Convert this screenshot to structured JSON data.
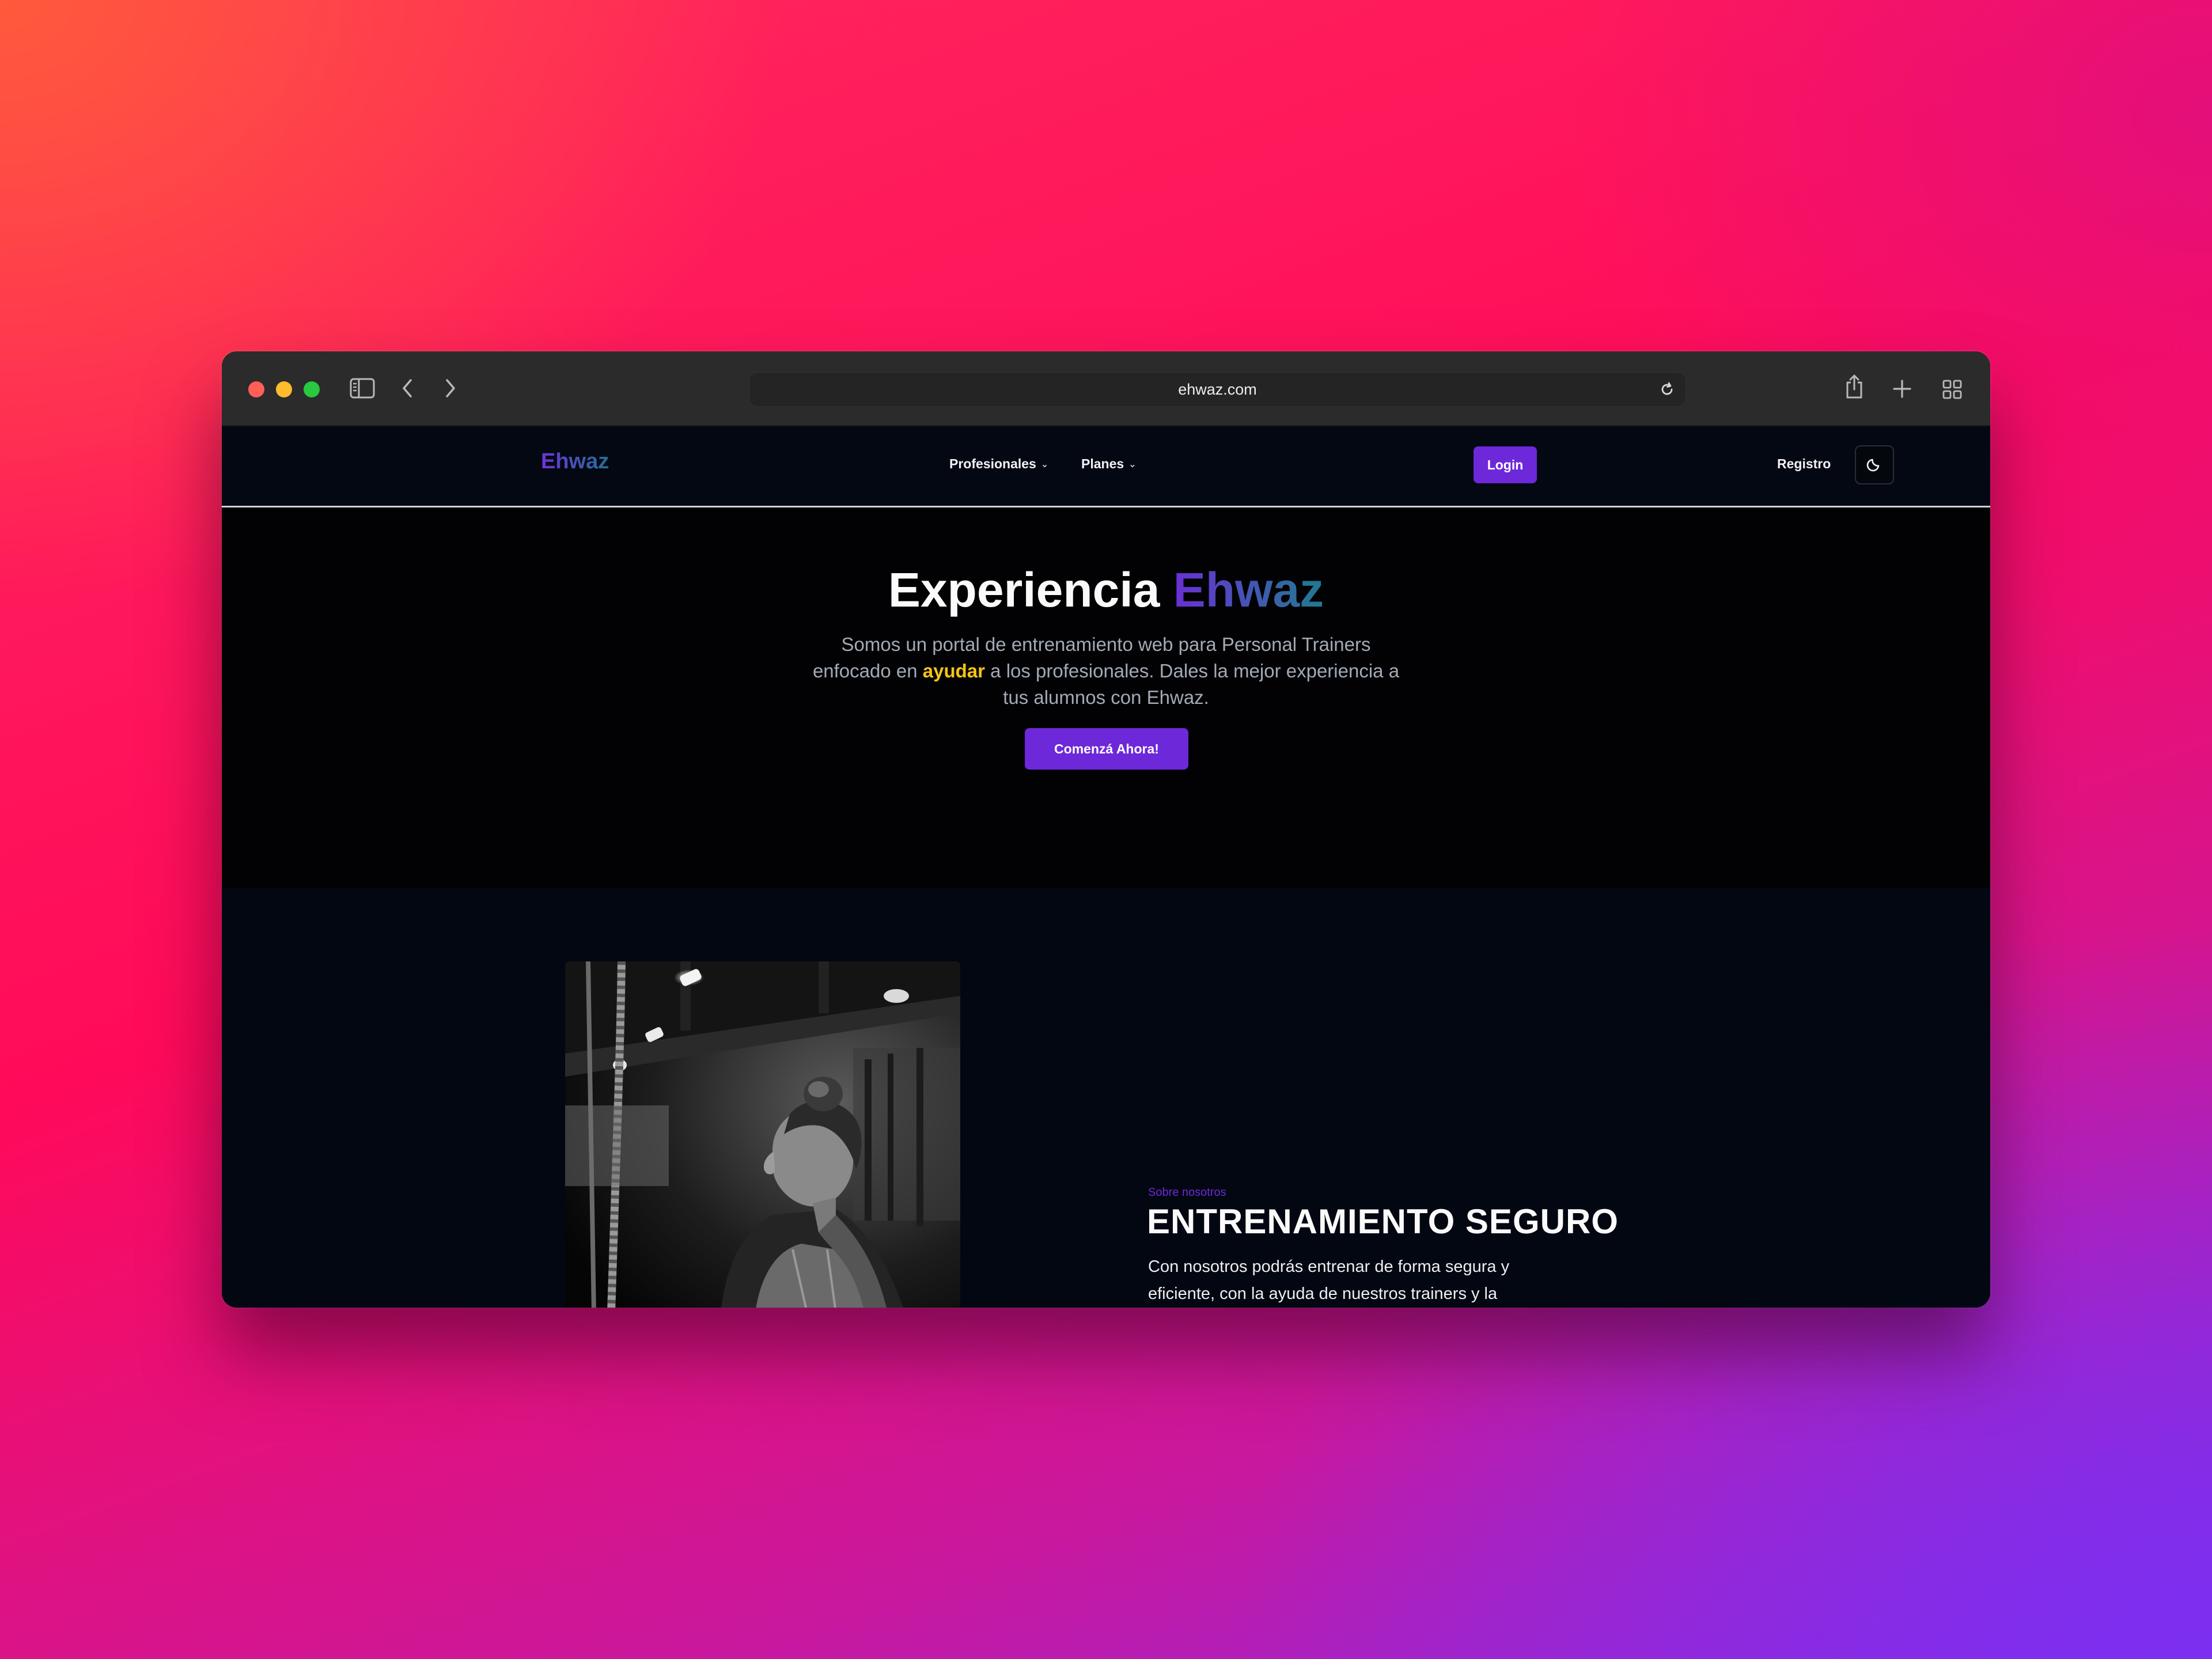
{
  "browser": {
    "url": "ehwaz.com"
  },
  "site": {
    "brand": "Ehwaz",
    "nav": {
      "items": [
        {
          "label": "Profesionales"
        },
        {
          "label": "Planes"
        }
      ],
      "login": "Login",
      "register": "Registro"
    },
    "hero": {
      "title_part1": "Experiencia",
      "title_part2": "Ehwaz",
      "subtitle_before": "Somos un portal de entrenamiento web para Personal Trainers enfocado en",
      "subtitle_highlight": "ayudar",
      "subtitle_after": "a los profesionales. Dales la mejor experiencia a tus alumnos con Ehwaz.",
      "cta": "Comenzá Ahora!"
    },
    "about": {
      "kicker": "Sobre nosotros",
      "title": "ENTRENAMIENTO SEGURO",
      "text": "Con nosotros podrás entrenar de forma segura y eficiente, con la ayuda de nuestros trainers y la"
    }
  },
  "colors": {
    "accent": "#6d28d9",
    "highlight": "#f6c514",
    "brand_gradient_start": "#6a2fd6",
    "brand_gradient_end": "#1f7b8f"
  },
  "icons": {
    "toolbar": [
      "sidebar-icon",
      "back-icon",
      "forward-icon",
      "reload-icon",
      "share-icon",
      "new-tab-icon",
      "tab-overview-icon"
    ],
    "theme": "moon-icon"
  }
}
